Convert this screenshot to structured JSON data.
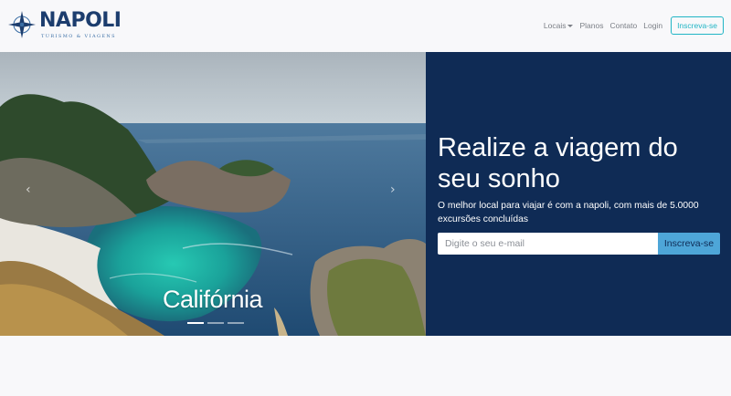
{
  "brand": {
    "name": "NAPOLI",
    "tagline": "TURISMO & VIAGENS"
  },
  "nav": {
    "links": [
      {
        "label": "Locais",
        "dropdown": true
      },
      {
        "label": "Planos"
      },
      {
        "label": "Contato"
      },
      {
        "label": "Login"
      }
    ],
    "cta": "Inscreva-se"
  },
  "carousel": {
    "caption": "Califórnia",
    "slides_count": 3,
    "active_slide": 1
  },
  "hero": {
    "title": "Realize a viagem do seu sonho",
    "text": "O melhor local para viajar é com a napoli, com mais de 5.0000 excursões concluídas",
    "email_placeholder": "Digite o seu e-mail",
    "submit_label": "Inscreva-se"
  },
  "colors": {
    "brand": "#1c3d6e",
    "hero_bg": "#0f2b55",
    "accent": "#21b5c5",
    "button": "#4ea6d8"
  }
}
